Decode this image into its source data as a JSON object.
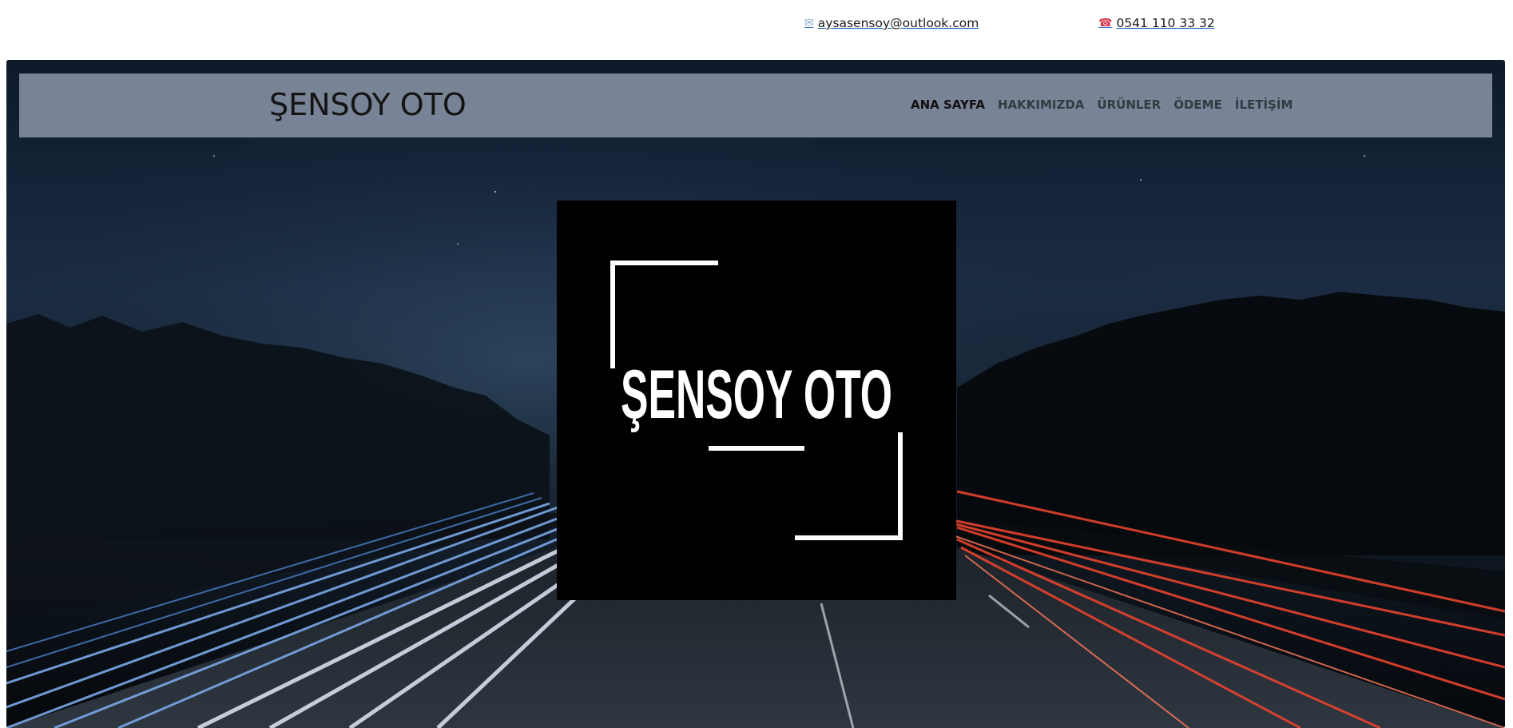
{
  "header": {
    "email": {
      "icon": "envelope-icon",
      "text": "aysasensoy@outlook.com"
    },
    "phone": {
      "icon": "telephone-icon",
      "text": "0541 110 33 32"
    }
  },
  "navbar": {
    "brand": "ŞENSOY OTO",
    "items": [
      {
        "label": "ANA SAYFA",
        "active": true
      },
      {
        "label": "HAKKIMIZDA",
        "active": false
      },
      {
        "label": "ÜRÜNLER",
        "active": false
      },
      {
        "label": "ÖDEME",
        "active": false
      },
      {
        "label": "İLETİŞİM",
        "active": false
      }
    ]
  },
  "hero": {
    "logo_text": "ŞENSOY OTO"
  },
  "colors": {
    "navbar_bg": "#8a94a8",
    "logo_bg": "#000000",
    "logo_fg": "#ffffff",
    "trail_blue": "#6f9fe0",
    "trail_red": "#e8432e"
  }
}
